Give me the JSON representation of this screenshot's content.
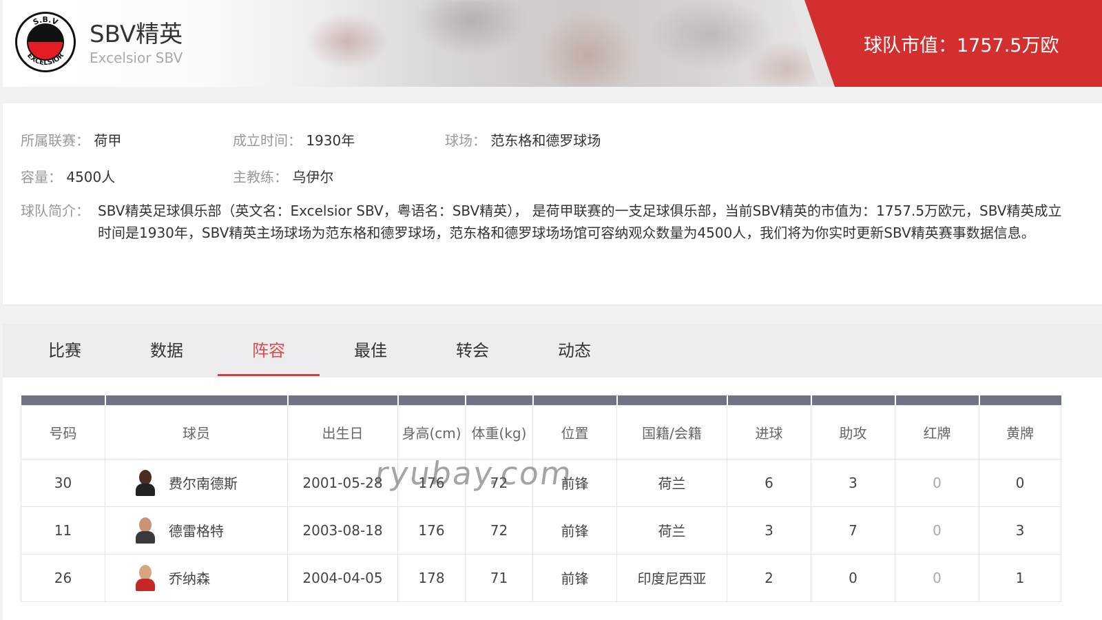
{
  "header": {
    "team_name": "SBV精英",
    "team_name_en": "Excelsior SBV",
    "market_value": "球队市值：1757.5万欧",
    "logo_text": "S.B.V EXCELSIOR",
    "accent_color": "#d32f2f"
  },
  "info": {
    "league_label": "所属联赛：",
    "league_value": "荷甲",
    "founded_label": "成立时间：",
    "founded_value": "1930年",
    "stadium_label": "球场：",
    "stadium_value": "范东格和德罗球场",
    "capacity_label": "容量：",
    "capacity_value": "4500人",
    "coach_label": "主教练：",
    "coach_value": "乌伊尔",
    "intro_label": "球队简介：",
    "intro_value": "SBV精英足球俱乐部（英文名：Excelsior SBV，粤语名：SBV精英）， 是荷甲联赛的一支足球俱乐部，当前SBV精英的市值为：1757.5万欧元，SBV精英成立时间是1930年，SBV精英主场球场为范东格和德罗球场，范东格和德罗球场场馆可容纳观众数量为4500人，我们将为你实时更新SBV精英赛事数据信息。"
  },
  "tabs": [
    {
      "label": "比赛"
    },
    {
      "label": "数据"
    },
    {
      "label": "阵容"
    },
    {
      "label": "最佳"
    },
    {
      "label": "转会"
    },
    {
      "label": "动态"
    }
  ],
  "active_tab": "阵容",
  "table": {
    "headers": [
      "号码",
      "球员",
      "出生日",
      "身高(cm)",
      "体重(kg)",
      "位置",
      "国籍/会籍",
      "进球",
      "助攻",
      "红牌",
      "黄牌"
    ],
    "rows": [
      {
        "number": "30",
        "name": "费尔南德斯",
        "birth": "2001-05-28",
        "height": "176",
        "weight": "72",
        "position": "前锋",
        "nationality": "荷兰",
        "goals": "6",
        "assists": "3",
        "red": "0",
        "yellow": "0",
        "avatar_skin": "#4a2c22",
        "avatar_shirt": "#222222"
      },
      {
        "number": "11",
        "name": "德雷格特",
        "birth": "2003-08-18",
        "height": "176",
        "weight": "72",
        "position": "前锋",
        "nationality": "荷兰",
        "goals": "3",
        "assists": "7",
        "red": "0",
        "yellow": "3",
        "avatar_skin": "#c89478",
        "avatar_shirt": "#3a3a3a"
      },
      {
        "number": "26",
        "name": "乔纳森",
        "birth": "2004-04-05",
        "height": "178",
        "weight": "71",
        "position": "前锋",
        "nationality": "印度尼西亚",
        "goals": "2",
        "assists": "0",
        "red": "0",
        "yellow": "1",
        "avatar_skin": "#d6a583",
        "avatar_shirt": "#c62828"
      }
    ]
  },
  "watermark": "ryubay.com"
}
